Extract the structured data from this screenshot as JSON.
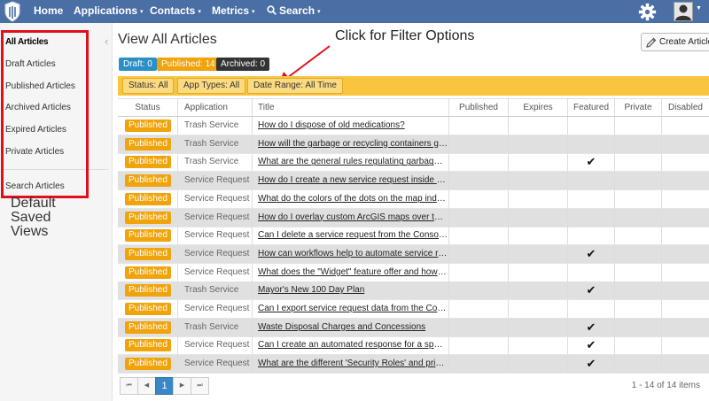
{
  "nav": {
    "items": [
      {
        "label": "Home",
        "caret": ""
      },
      {
        "label": "Applications",
        "caret": "▾"
      },
      {
        "label": "Contacts",
        "caret": "▾"
      },
      {
        "label": "Metrics",
        "caret": "▾"
      },
      {
        "label": "Search",
        "caret": "▾"
      }
    ],
    "bar_color": "#4a6fa5"
  },
  "sidebar": {
    "items": [
      {
        "label": "All Articles",
        "active": true
      },
      {
        "label": "Draft Articles"
      },
      {
        "label": "Published Articles"
      },
      {
        "label": "Archived Articles"
      },
      {
        "label": "Expired Articles"
      },
      {
        "label": "Private Articles"
      },
      {
        "label": "Search Articles"
      }
    ],
    "annotation": [
      "Default",
      "Saved",
      "Views"
    ]
  },
  "page": {
    "title": "View All Articles",
    "create_label": "Create Article",
    "annotation": "Click for Filter Options"
  },
  "counts": [
    {
      "label": "Draft: 0",
      "color": "#2a8fc7"
    },
    {
      "label": "Published: 14",
      "color": "#f0a30a"
    },
    {
      "label": "Archived: 0",
      "color": "#333333"
    }
  ],
  "filters": [
    "Status: All",
    "App Types: All",
    "Date Range: All Time"
  ],
  "table": {
    "columns": [
      "Status",
      "Application",
      "Title",
      "Published",
      "Expires",
      "Featured",
      "Private",
      "Disabled"
    ],
    "rows": [
      {
        "status": "Published",
        "app": "Trash Service",
        "title": "How do I dispose of old medications?",
        "featured": false
      },
      {
        "status": "Published",
        "app": "Trash Service",
        "title": "How will the garbage or recycling containers get...",
        "featured": false
      },
      {
        "status": "Published",
        "app": "Trash Service",
        "title": "What are the general rules regulating garbage or r...",
        "featured": true
      },
      {
        "status": "Published",
        "app": "Service Request",
        "title": "How do I create a new service request inside the ...",
        "featured": false
      },
      {
        "status": "Published",
        "app": "Service Request",
        "title": "What do the colors of the dots on the map indica...",
        "featured": false
      },
      {
        "status": "Published",
        "app": "Service Request",
        "title": "How do I overlay custom ArcGIS maps over the C...",
        "featured": false
      },
      {
        "status": "Published",
        "app": "Service Request",
        "title": "Can I delete a service request from the Console?",
        "featured": false
      },
      {
        "status": "Published",
        "app": "Service Request",
        "title": "How can workflows help to automate service req...",
        "featured": true
      },
      {
        "status": "Published",
        "app": "Service Request",
        "title": "What does the \"Widget\" feature offer and how do ...",
        "featured": false
      },
      {
        "status": "Published",
        "app": "Trash Service",
        "title": "Mayor's New 100 Day Plan",
        "featured": true
      },
      {
        "status": "Published",
        "app": "Service Request",
        "title": "Can I export service request data from the Consol...",
        "featured": false
      },
      {
        "status": "Published",
        "app": "Trash Service",
        "title": "Waste Disposal Charges and Concessions",
        "featured": true
      },
      {
        "status": "Published",
        "app": "Service Request",
        "title": "Can I create an automated response for a specific...",
        "featured": true
      },
      {
        "status": "Published",
        "app": "Service Request",
        "title": "What are the different 'Security Roles' and privileg...",
        "featured": true
      }
    ],
    "check_glyph": "✔"
  },
  "pager": {
    "first": "⏮",
    "prev": "◀",
    "current": "1",
    "next": "▶",
    "last": "⏭",
    "info": "1 - 14 of 14 items"
  }
}
